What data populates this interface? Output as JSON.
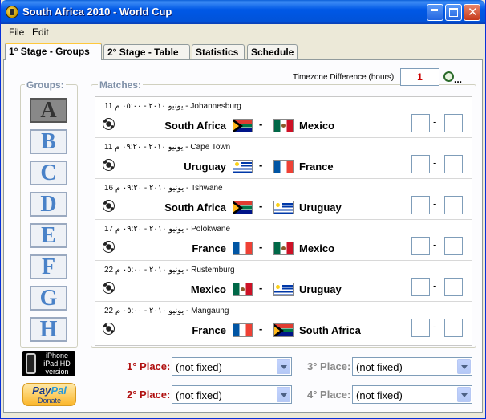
{
  "window": {
    "title": "South Africa 2010 - World Cup"
  },
  "menu": [
    "File",
    "Edit"
  ],
  "tabs": [
    "1° Stage - Groups",
    "2° Stage - Table",
    "Statistics",
    "Schedule"
  ],
  "groups_panel": {
    "label": "Groups:",
    "items": [
      "A",
      "B",
      "C",
      "D",
      "E",
      "F",
      "G",
      "H"
    ],
    "selected": "A"
  },
  "matches_panel": {
    "label": "Matches:",
    "timezone_label": "Timezone Difference (hours):",
    "timezone_value": "1",
    "timezone_button_text": "...",
    "matches": [
      {
        "date": "11 يونيو ٢٠١٠ - ٠٥:٠٠ م - Johannesburg",
        "home": "South Africa",
        "away": "Mexico"
      },
      {
        "date": "11 يونيو ٢٠١٠ - ٠٩:٢٠ م - Cape Town",
        "home": "Uruguay",
        "away": "France"
      },
      {
        "date": "16 يونيو ٢٠١٠ - ٠٩:٢٠ م - Tshwane",
        "home": "South Africa",
        "away": "Uruguay"
      },
      {
        "date": "17 يونيو ٢٠١٠ - ٠٩:٢٠ م - Polokwane",
        "home": "France",
        "away": "Mexico"
      },
      {
        "date": "22 يونيو ٢٠١٠ - ٠٥:٠٠ م - Rustemburg",
        "home": "Mexico",
        "away": "Uruguay"
      },
      {
        "date": "22 يونيو ٢٠١٠ - ٠٥:٠٠ م - Mangaung",
        "home": "France",
        "away": "South Africa"
      }
    ],
    "score_separator": "-",
    "vs_separator": "-"
  },
  "places": {
    "first_label": "1° Place:",
    "second_label": "2° Place:",
    "third_label": "3° Place:",
    "fourth_label": "4° Place:",
    "first_value": "(not fixed)",
    "second_value": "(not fixed)",
    "third_value": "(not fixed)",
    "fourth_value": "(not fixed)"
  },
  "badges": {
    "iphone_line1": "iPhone",
    "iphone_line2": "iPad HD",
    "iphone_line3": "version",
    "paypal_pay": "Pay",
    "paypal_pal": "Pal",
    "paypal_donate": "Donate"
  },
  "colors": {
    "first_place_label": "#b01010",
    "second_place_label": "#b01010",
    "third_place_label": "#888888",
    "fourth_place_label": "#888888",
    "timezone_value": "#cc0000"
  }
}
